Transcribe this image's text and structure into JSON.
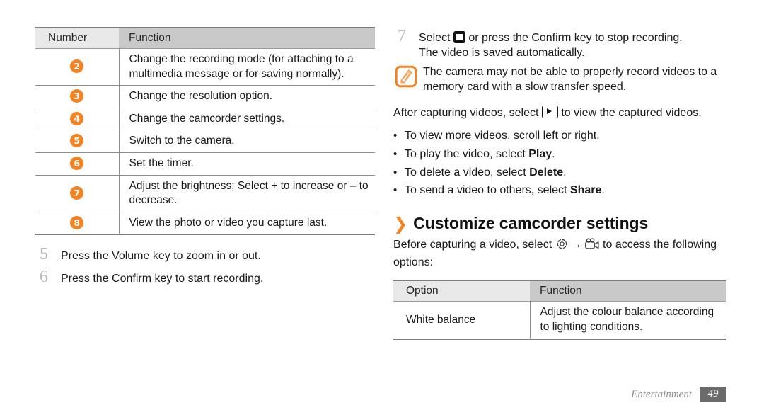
{
  "left_column": {
    "table": {
      "headers": [
        "Number",
        "Function"
      ],
      "rows": [
        {
          "number": "2",
          "function": "Change the recording mode (for attaching to a multimedia message or for saving normally)."
        },
        {
          "number": "3",
          "function": "Change the resolution option."
        },
        {
          "number": "4",
          "function": "Change the camcorder settings."
        },
        {
          "number": "5",
          "function": "Switch to the camera."
        },
        {
          "number": "6",
          "function": "Set the timer."
        },
        {
          "number": "7",
          "function": "Adjust the brightness; Select + to increase or – to decrease."
        },
        {
          "number": "8",
          "function": "View the photo or video you capture last."
        }
      ]
    },
    "steps": [
      {
        "num": "5",
        "text": "Press the Volume key to zoom in or out."
      },
      {
        "num": "6",
        "text": "Press the Confirm key to start recording."
      }
    ]
  },
  "right_column": {
    "step7": {
      "num": "7",
      "text_before_icon": "Select ",
      "icon": "stop-recording-icon",
      "text_after_icon": " or press the Confirm key to stop recording.",
      "second_line": "The video is saved automatically."
    },
    "note": {
      "icon": "note-pen-icon",
      "text": "The camera may not be able to properly record videos to a memory card with a slow transfer speed."
    },
    "after_capture": {
      "text_before_icon": "After capturing videos, select ",
      "icon": "play-gallery-icon",
      "text_after_icon": " to view the captured videos."
    },
    "bullets": [
      {
        "bullet": "•",
        "plain_before": "To view more videos, scroll left or right.",
        "bold": "",
        "plain_after": ""
      },
      {
        "bullet": "•",
        "plain_before": "To play the video, select ",
        "bold": "Play",
        "plain_after": "."
      },
      {
        "bullet": "•",
        "plain_before": "To delete a video, select ",
        "bold": "Delete",
        "plain_after": "."
      },
      {
        "bullet": "•",
        "plain_before": "To send a video to others, select ",
        "bold": "Share",
        "plain_after": "."
      }
    ],
    "heading": {
      "chevron": "❯",
      "title": "Customize camcorder settings"
    },
    "intro": {
      "text_before_gear": "Before capturing a video, select ",
      "gear_icon": "settings-gear-icon",
      "arrow": "→",
      "camcorder_icon": "camcorder-icon",
      "text_after": " to access the following options:"
    },
    "table": {
      "headers": [
        "Option",
        "Function"
      ],
      "rows": [
        {
          "option": "White balance",
          "function": "Adjust the colour balance according to lighting conditions."
        }
      ]
    }
  },
  "footer": {
    "section": "Entertainment",
    "page_number": "49"
  },
  "colors": {
    "accent_orange": "#f58220",
    "header_light": "#e9e9e9",
    "header_dark": "#c9c9c9",
    "rule": "#7d7d7d",
    "footer_box": "#6b6b6b"
  }
}
